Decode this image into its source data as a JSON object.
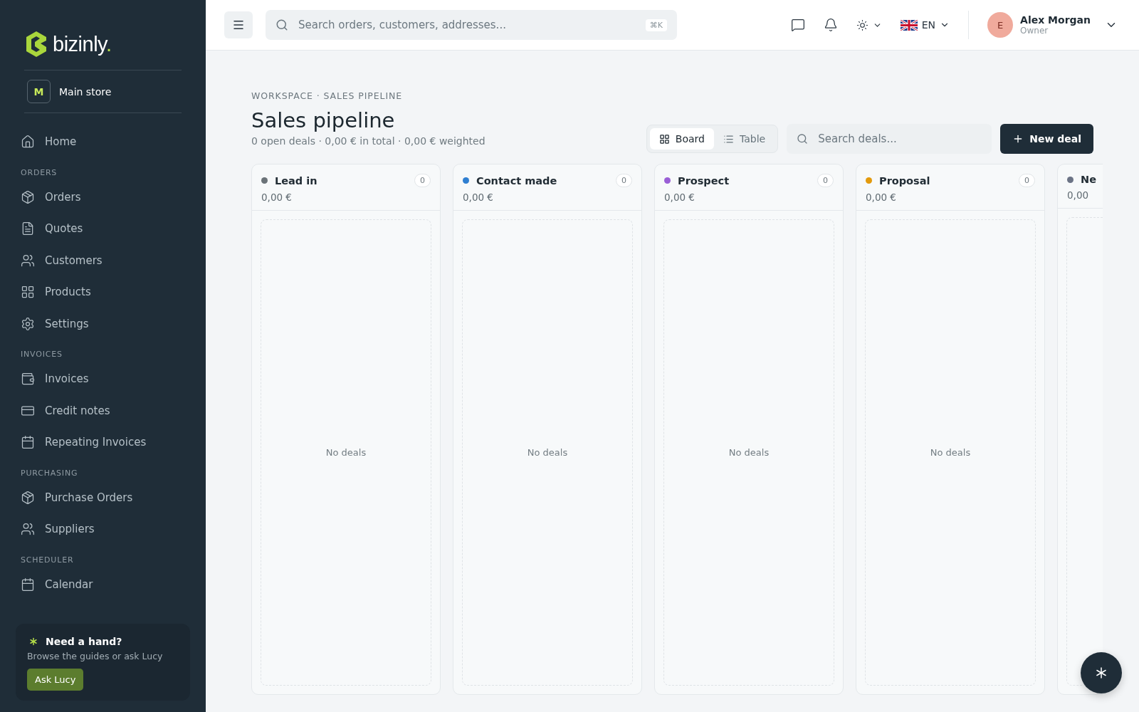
{
  "brand": {
    "name": "bizinly",
    "dot": "."
  },
  "store": {
    "initial": "M",
    "name": "Main store"
  },
  "sidebar": {
    "items": [
      {
        "kind": "item",
        "label": "Home"
      },
      {
        "kind": "heading",
        "label": "ORDERS"
      },
      {
        "kind": "item",
        "label": "Orders"
      },
      {
        "kind": "item",
        "label": "Quotes"
      },
      {
        "kind": "item",
        "label": "Customers"
      },
      {
        "kind": "item",
        "label": "Products"
      },
      {
        "kind": "item",
        "label": "Settings"
      },
      {
        "kind": "heading",
        "label": "INVOICES"
      },
      {
        "kind": "item",
        "label": "Invoices"
      },
      {
        "kind": "item",
        "label": "Credit notes"
      },
      {
        "kind": "item",
        "label": "Repeating Invoices"
      },
      {
        "kind": "heading",
        "label": "PURCHASING"
      },
      {
        "kind": "item",
        "label": "Purchase Orders"
      },
      {
        "kind": "item",
        "label": "Suppliers"
      },
      {
        "kind": "heading",
        "label": "SCHEDULER"
      },
      {
        "kind": "item",
        "label": "Calendar"
      }
    ]
  },
  "help": {
    "title": "Need a hand?",
    "text": "Browse the guides or ask Lucy",
    "button": "Ask Lucy"
  },
  "topbar": {
    "search_placeholder": "Search orders, customers, addresses...",
    "shortcut": "⌘K",
    "language": "EN",
    "user": {
      "initial": "E",
      "name": "Alex Morgan",
      "role": "Owner"
    }
  },
  "page": {
    "breadcrumb": "WORKSPACE · SALES PIPELINE",
    "title": "Sales pipeline",
    "summary": "0 open deals · 0,00 € in total · 0,00 € weighted"
  },
  "views": [
    {
      "label": "Board",
      "selected": true
    },
    {
      "label": "Table",
      "selected": false
    }
  ],
  "deal_search": {
    "placeholder": "Search deals..."
  },
  "new_deal": "New deal",
  "columns": [
    {
      "name": "Lead in",
      "color": "#6b7378",
      "total": "0,00 €",
      "count": "0",
      "empty": "No deals"
    },
    {
      "name": "Contact made",
      "color": "#2f7fd1",
      "total": "0,00 €",
      "count": "0",
      "empty": "No deals"
    },
    {
      "name": "Prospect",
      "color": "#9a5fd6",
      "total": "0,00 €",
      "count": "0",
      "empty": "No deals"
    },
    {
      "name": "Proposal",
      "color": "#e39a0c",
      "total": "0,00 €",
      "count": "0",
      "empty": "No deals"
    },
    {
      "name": "Ne",
      "color": "#6b7385",
      "total": "0,00"
    }
  ]
}
